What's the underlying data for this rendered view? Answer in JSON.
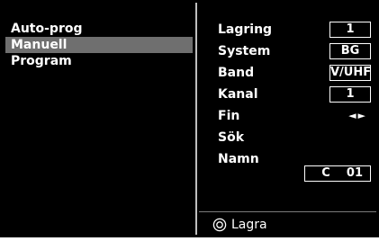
{
  "menu": {
    "items": [
      {
        "label": "Auto-prog",
        "selected": false
      },
      {
        "label": "Manuell",
        "selected": true
      },
      {
        "label": "Program",
        "selected": false
      }
    ]
  },
  "settings": {
    "lagring": {
      "label": "Lagring",
      "value": "1"
    },
    "system": {
      "label": "System",
      "value": "BG"
    },
    "band": {
      "label": "Band",
      "value": "V/UHF"
    },
    "kanal": {
      "label": "Kanal",
      "value": "1"
    },
    "fin": {
      "label": "Fin",
      "value": "◄►"
    },
    "sok": {
      "label": "Sök"
    },
    "namn": {
      "label": "Namn",
      "value": "C    01"
    }
  },
  "footer": {
    "icon": "ok-circle-icon",
    "label": "Lagra"
  },
  "colors": {
    "background": "#000000",
    "text": "#ffffff",
    "selection": "#6f6f6f",
    "divider": "#bfbfbf"
  }
}
